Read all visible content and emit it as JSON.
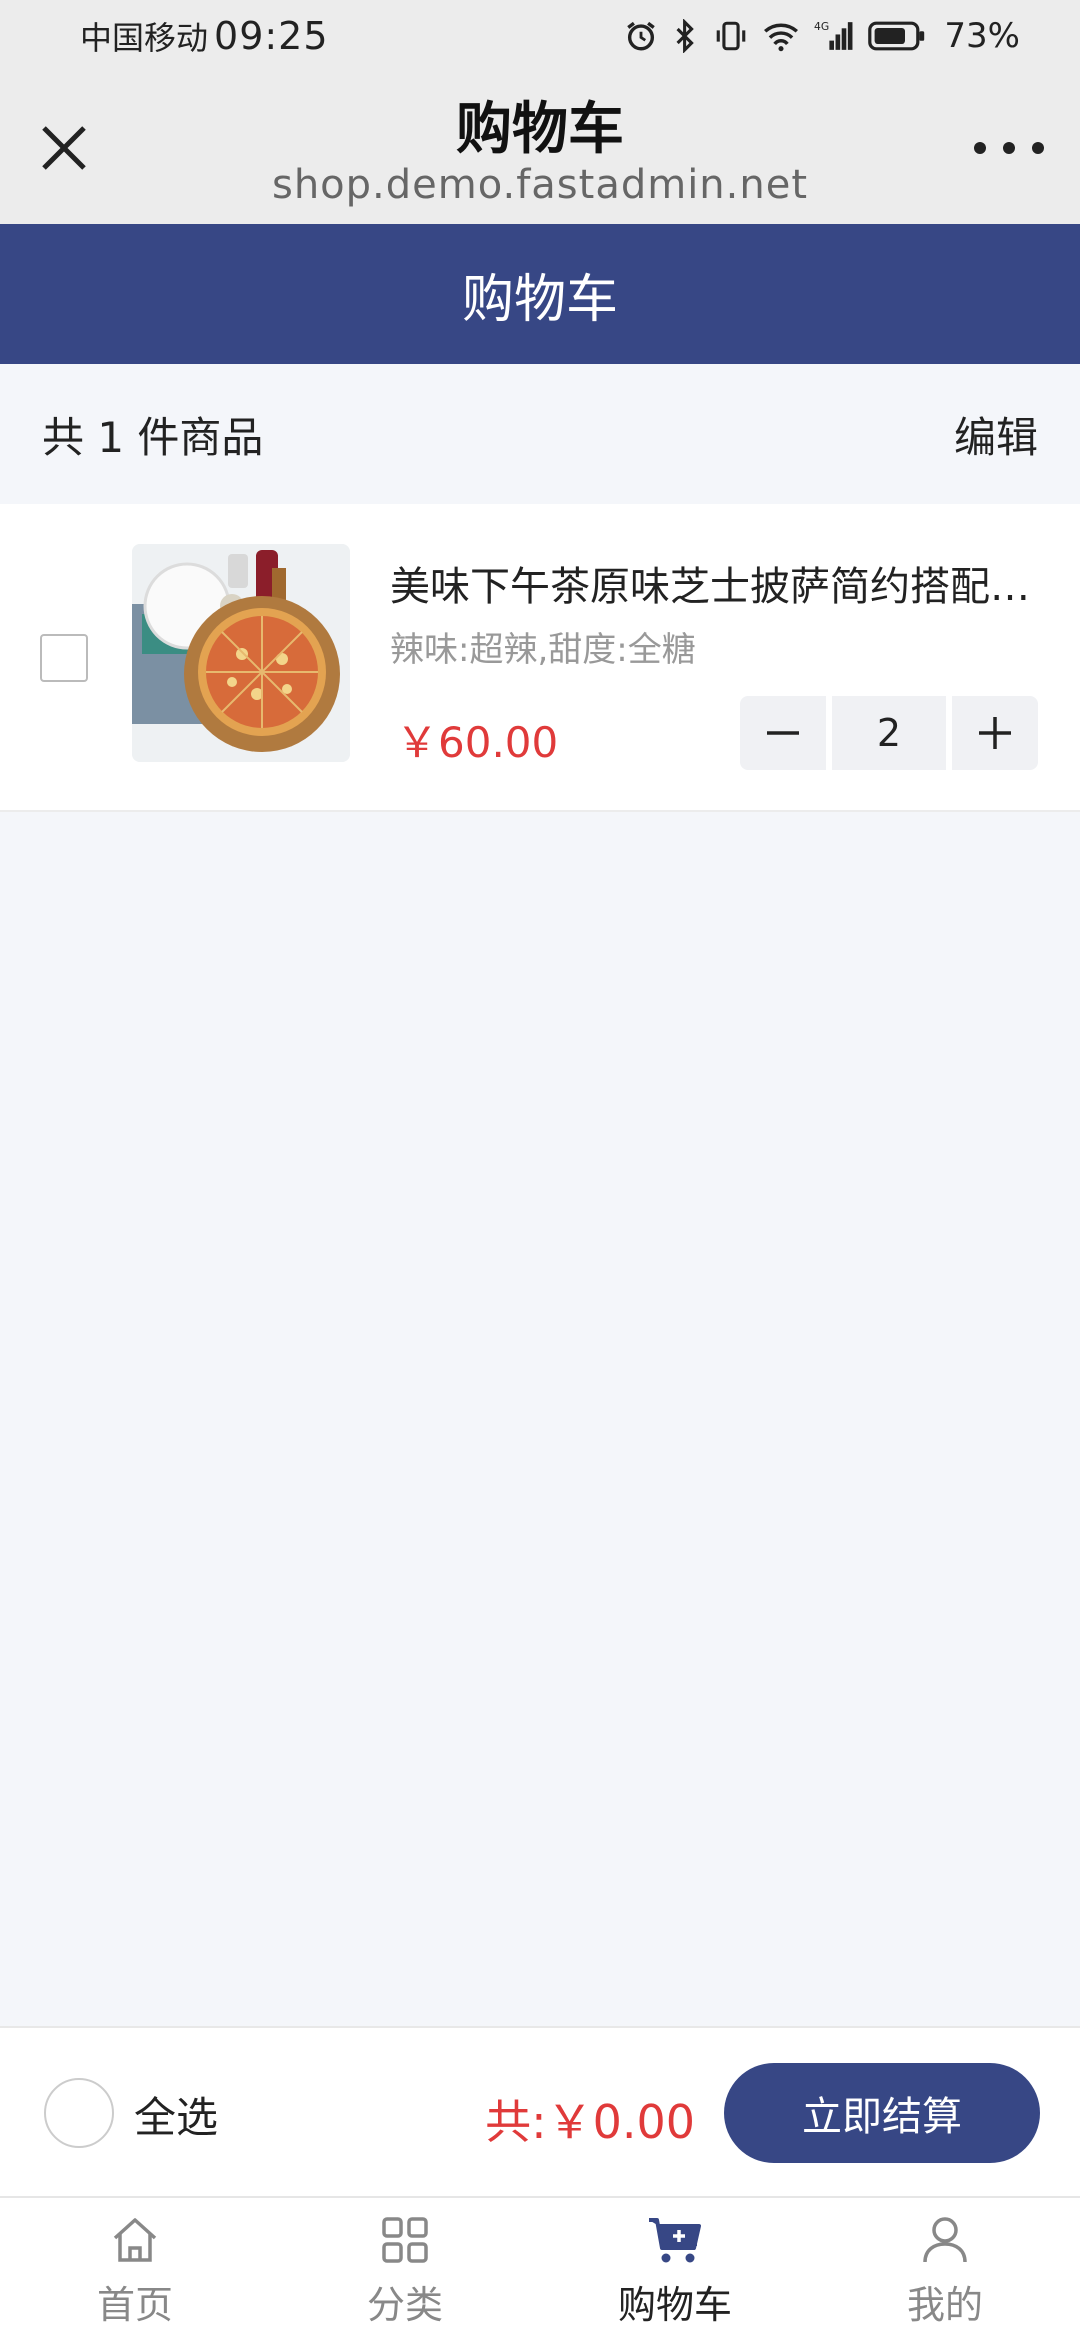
{
  "status_bar": {
    "carrier": "中国移动",
    "time": "09:25",
    "battery": "73%"
  },
  "webview": {
    "title": "购物车",
    "url": "shop.demo.fastadmin.net"
  },
  "header": {
    "title": "购物车"
  },
  "cart": {
    "count_text": "共 1 件商品",
    "edit_label": "编辑",
    "items": [
      {
        "title": "美味下午茶原味芝士披萨简约搭配下午茶",
        "spec": "辣味:超辣,甜度:全糖",
        "price": "￥60.00",
        "quantity": "2",
        "checked": false
      }
    ]
  },
  "checkout": {
    "select_all_label": "全选",
    "total_prefix": "共:",
    "total_value": "￥0.00",
    "button_label": "立即结算"
  },
  "tabs": [
    {
      "label": "首页",
      "icon": "home-icon",
      "active": false
    },
    {
      "label": "分类",
      "icon": "grid-icon",
      "active": false
    },
    {
      "label": "购物车",
      "icon": "cart-icon",
      "active": true
    },
    {
      "label": "我的",
      "icon": "user-icon",
      "active": false
    }
  ],
  "colors": {
    "primary": "#374785",
    "price": "#e03a3a",
    "background": "#f4f6fa"
  }
}
